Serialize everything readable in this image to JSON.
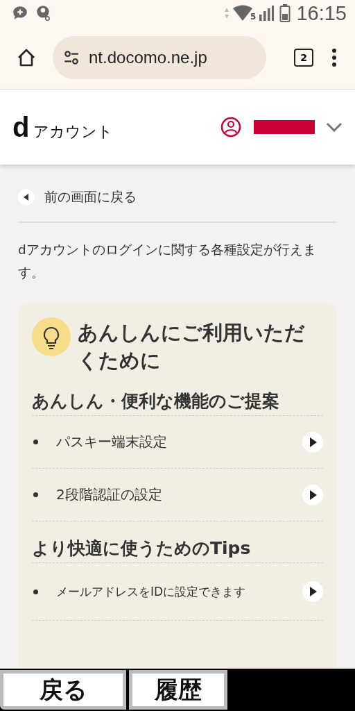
{
  "status_bar": {
    "time": "16:15",
    "network_badge": "5"
  },
  "browser": {
    "url": "nt.docomo.ne.jp",
    "tab_count": "2"
  },
  "header": {
    "logo_mark": "d",
    "logo_text": "アカウント"
  },
  "back_link": "前の画面に戻る",
  "description": "dアカウントのログインに関する各種設定が行えます。",
  "card": {
    "title": "あんしんにご利用いただくために",
    "sections": [
      {
        "heading": "あんしん・便利な機能のご提案",
        "items": [
          {
            "label": "パスキー端末設定",
            "kind": "large"
          },
          {
            "label": "2段階認証の設定",
            "kind": "large"
          }
        ]
      },
      {
        "heading": "より快適に使うためのTips",
        "items": [
          {
            "label": "メールアドレスをIDに設定できます",
            "kind": "small"
          }
        ]
      }
    ]
  },
  "bottom_buttons": [
    "戻る",
    "履歴"
  ]
}
